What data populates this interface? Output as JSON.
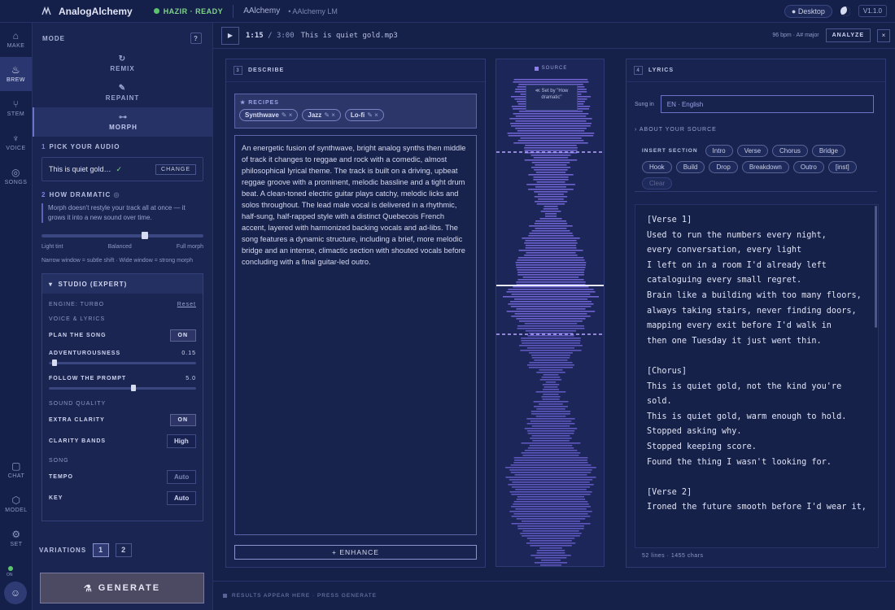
{
  "topbar": {
    "app_name": "AnalogAlchemy",
    "status": "HAZIR · READY",
    "model_name": "AAlchemy",
    "model_sub": "• AAlchemy LM",
    "desktop_label": "● Desktop",
    "version": "V1.1.0"
  },
  "rail": [
    {
      "label": "MAKE",
      "icon": "flask-icon"
    },
    {
      "label": "BREW",
      "icon": "cauldron-icon",
      "active": true
    },
    {
      "label": "STEM",
      "icon": "stem-icon"
    },
    {
      "label": "VOICE",
      "icon": "microphone-icon"
    },
    {
      "label": "SONGS",
      "icon": "disc-icon"
    },
    {
      "label": "CHAT",
      "icon": "chat-icon"
    },
    {
      "label": "MODEL",
      "icon": "cube-icon"
    },
    {
      "label": "SET",
      "icon": "gear-icon"
    }
  ],
  "rail_status": "ON",
  "panel": {
    "mode_label": "MODE",
    "help": "?",
    "modes": [
      {
        "label": "REMIX",
        "icon": "remix-icon"
      },
      {
        "label": "REPAINT",
        "icon": "brush-icon"
      },
      {
        "label": "MORPH",
        "icon": "morph-icon",
        "active": true
      }
    ],
    "pick_num": "1",
    "pick_title": "PICK YOUR AUDIO",
    "file_name": "This is quiet gold…",
    "change_label": "CHANGE",
    "dramatic_num": "2",
    "dramatic_title": "HOW DRAMATIC",
    "dramatic_note": "Morph doesn't restyle your track all at once — it grows it into a new sound over time.",
    "dramatic_value": 0.62,
    "slider_labels": [
      "Light tint",
      "Balanced",
      "Full morph"
    ],
    "dramatic_hint": "Narrow window = subtle shift · Wide window = strong morph",
    "studio": {
      "title": "STUDIO (EXPERT)",
      "engine": "ENGINE: TURBO",
      "reset": "Reset",
      "voice_lyrics": "VOICE & LYRICS",
      "plan_song": "PLAN THE SONG",
      "plan_song_val": "ON",
      "adventurousness": "ADVENTUROUSNESS",
      "adventurousness_val": "0.15",
      "follow_prompt": "FOLLOW THE PROMPT",
      "follow_prompt_val": "5.0",
      "sound_quality": "SOUND QUALITY",
      "extra_clarity": "EXTRA CLARITY",
      "extra_clarity_val": "ON",
      "clarity_bands": "CLARITY BANDS",
      "clarity_bands_val": "High",
      "song": "SONG",
      "tempo": "TEMPO",
      "tempo_val": "Auto",
      "key": "KEY",
      "key_val": "Auto"
    },
    "variations_label": "VARIATIONS",
    "variations": [
      "1",
      "2"
    ],
    "generate_label": "GENERATE"
  },
  "player": {
    "time": "1:15",
    "duration": "/ 3:00",
    "file": "This is quiet gold.mp3",
    "info": "96 bpm · A# major",
    "analyze": "ANALYZE",
    "close": "×"
  },
  "describe": {
    "num": "3",
    "title": "DESCRIBE",
    "recipes_label": "RECIPES",
    "recipes": [
      "Synthwave",
      "Jazz",
      "Lo-fi"
    ],
    "text": "An energetic fusion of synthwave, bright analog synths then middle of track it changes to reggae and rock with a comedic, almost philosophical lyrical theme. The track is built on a driving, upbeat reggae groove with a prominent, melodic bassline and a tight drum beat. A clean-toned electric guitar plays catchy, melodic licks and solos throughout. The lead male vocal is delivered in a rhythmic, half-sung, half-rapped style with a distinct Quebecois French accent, layered with harmonized backing vocals and ad-libs. The song features a dynamic structure, including a brief, more melodic bridge and an intense, climactic section with shouted vocals before concluding with a final guitar-led outro.",
    "enhance": "+ ENHANCE"
  },
  "source": {
    "label": "SOURCE",
    "tip": "≪ Set by \"How dramatic\""
  },
  "lyrics": {
    "num": "4",
    "title": "LYRICS",
    "sung_in": "Sung in",
    "language": "EN · English",
    "about": "› ABOUT YOUR SOURCE",
    "insert_label": "INSERT SECTION",
    "sections": [
      "Intro",
      "Verse",
      "Chorus",
      "Bridge",
      "Hook",
      "Build",
      "Drop",
      "Breakdown",
      "Outro",
      "[inst]"
    ],
    "clear": "Clear",
    "text": "[Verse 1]\nUsed to run the numbers every night,\nevery conversation, every light\nI left on in a room I'd already left\ncataloguing every small regret.\nBrain like a building with too many floors,\nalways taking stairs, never finding doors,\nmapping every exit before I'd walk in\nthen one Tuesday it just went thin.\n\n[Chorus]\nThis is quiet gold, not the kind you're sold.\nThis is quiet gold, warm enough to hold.\nStopped asking why.\nStopped keeping score.\nFound the thing I wasn't looking for.\n\n[Verse 2]\nIroned the future smooth before I'd wear it,",
    "footer": "52 lines · 1455 chars"
  },
  "results": "RESULTS APPEAR HERE · PRESS GENERATE"
}
